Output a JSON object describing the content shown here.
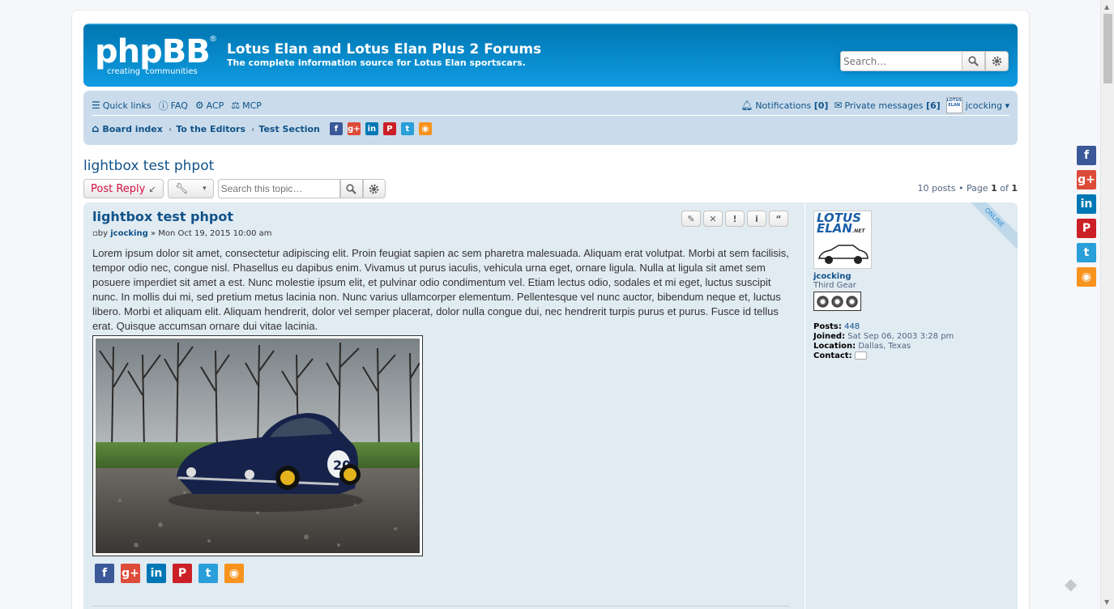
{
  "header": {
    "logo_text": "phpBB",
    "logo_reg": "®",
    "logo_tagline": [
      "creating",
      "communities"
    ],
    "site_title": "Lotus Elan and Lotus Elan Plus 2 Forums",
    "site_description": "The complete information source for Lotus Elan sportscars.",
    "search_placeholder": "Search…",
    "accent_color": "#12a3eb"
  },
  "nav": {
    "quick_links": "Quick links",
    "faq": "FAQ",
    "acp": "ACP",
    "mcp": "MCP",
    "notifications_label": "Notifications",
    "notifications_count": "[0]",
    "pm_label": "Private messages",
    "pm_count": "[6]",
    "user": "jcocking",
    "breadcrumbs": [
      "Board index",
      "To the Editors",
      "Test Section"
    ]
  },
  "share_icons": [
    "facebook-icon",
    "google-plus-icon",
    "linkedin-icon",
    "pinterest-icon",
    "twitter-icon",
    "rss-icon"
  ],
  "topic": {
    "title": "lightbox test phpot",
    "post_reply": "Post Reply",
    "search_placeholder": "Search this topic…",
    "posts_count": "10 posts",
    "page_label": "Page",
    "page_current": "1",
    "page_of": "of",
    "page_total": "1"
  },
  "post": {
    "title": "lightbox test phpot",
    "by": "by",
    "author": "jcocking",
    "date": "» Mon Oct 19, 2015 10:00 am",
    "body": "Lorem ipsum dolor sit amet, consectetur adipiscing elit. Proin feugiat sapien ac sem pharetra malesuada. Aliquam erat volutpat. Morbi at sem facilisis, tempor odio nec, congue nisl. Phasellus eu dapibus enim. Vivamus ut purus iaculis, vehicula urna eget, ornare ligula. Nulla at ligula sit amet sem posuere imperdiet sit amet a est. Nunc molestie ipsum elit, et pulvinar odio condimentum vel. Etiam lectus odio, sodales et mi eget, luctus suscipit nunc. In mollis dui mi, sed pretium metus lacinia non. Nunc varius ullamcorper elementum. Pellentesque vel nunc auctor, bibendum neque et, luctus libero. Morbi et aliquam elit. Aliquam hendrerit, dolor vel semper placerat, dolor nulla congue dui, nec hendrerit turpis purus et purus. Fusce id tellus erat. Quisque accumsan ornare dui vitae lacinia."
  },
  "profile": {
    "online": "ONLINE",
    "avatar_text": "LOTUS ELAN",
    "avatar_net": ".NET",
    "username": "jcocking",
    "rank": "Third Gear",
    "posts_label": "Posts:",
    "posts_value": "448",
    "joined_label": "Joined:",
    "joined_value": "Sat Sep 06, 2003 3:28 pm",
    "location_label": "Location:",
    "location_value": "Dallas, Texas",
    "contact_label": "Contact:"
  },
  "car_plate": "20"
}
